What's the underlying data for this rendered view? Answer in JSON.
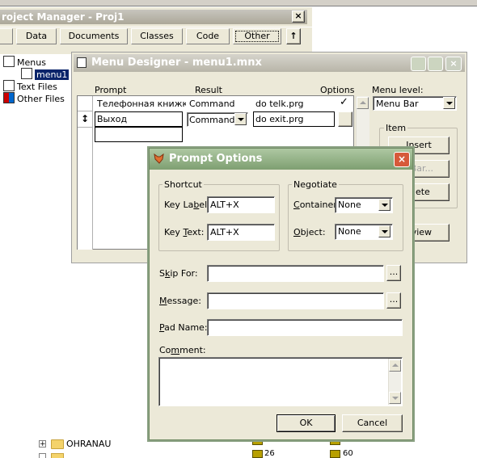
{
  "project_manager": {
    "title": "roject Manager - Proj1",
    "close": "×",
    "tabs": [
      "Data",
      "Documents",
      "Classes",
      "Code",
      "Other"
    ],
    "tab_arrow": "↑",
    "tree": [
      "Menus",
      "menu1",
      "Text Files",
      "Other Files"
    ]
  },
  "menu_designer": {
    "title": "Menu Designer - menu1.mnx",
    "headers": {
      "prompt": "Prompt",
      "result": "Result",
      "options": "Options",
      "menu_level": "Menu level:"
    },
    "rows": [
      {
        "prompt": "Телефонная книжка",
        "result": "Command",
        "command": "do telk.prg",
        "check": "✓"
      },
      {
        "prompt": "Выход",
        "result": "Command",
        "command": "do exit.prg",
        "check": ""
      }
    ],
    "row_marker": "↕",
    "menu_level_value": "Menu Bar",
    "item_group": "Item",
    "insert_btn": "Insert",
    "insert_bar_btn": "t Bar...",
    "delete_btn": "elete",
    "preview_btn": "eview"
  },
  "prompt_options": {
    "title": "Prompt Options",
    "close": "×",
    "shortcut_group": "Shortcut",
    "key_label_pre": "Key La",
    "key_label_ul": "b",
    "key_label_post": "el:",
    "key_label_value": "ALT+X",
    "key_text_pre": "Key ",
    "key_text_ul": "T",
    "key_text_post": "ext:",
    "key_text_value": "ALT+X",
    "negotiate_group": "Negotiate",
    "container_ul": "C",
    "container_post": "ontainer:",
    "container_value": "None",
    "object_ul": "O",
    "object_post": "bject:",
    "object_value": "None",
    "skip_for_pre": "S",
    "skip_for_ul": "k",
    "skip_for_post": "ip For:",
    "message_pre": "",
    "message_ul": "M",
    "message_post": "essage:",
    "pad_name_ul": "P",
    "pad_name_post": "ad Name:",
    "comment_pre": "Co",
    "comment_ul": "m",
    "comment_post": "ment:",
    "ellipsis": "...",
    "ok": "OK",
    "cancel": "Cancel"
  },
  "bottom": {
    "folder_label": "OHRANAU",
    "plus": "+",
    "num_a": "26",
    "num_b": "60"
  }
}
